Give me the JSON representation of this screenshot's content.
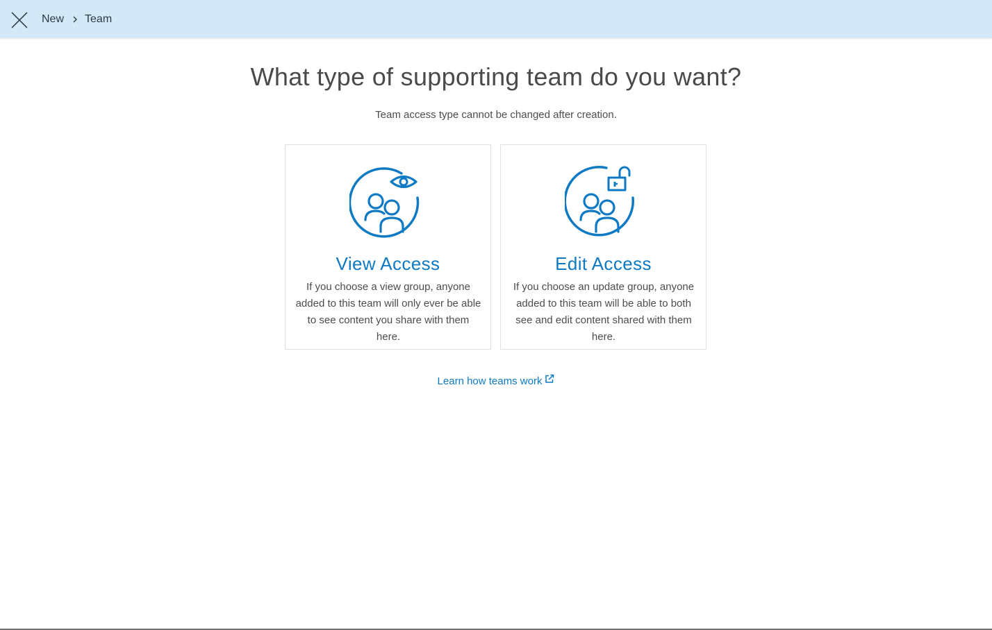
{
  "header": {
    "breadcrumb": [
      "New",
      "Team"
    ]
  },
  "main": {
    "title": "What type of supporting team do you want?",
    "subtitle": "Team access type cannot be changed after creation.",
    "cards": [
      {
        "title": "View Access",
        "description": "If you choose a view group, anyone added to this team will only ever be able to see content you share with them here.",
        "icon": "team-view-icon"
      },
      {
        "title": "Edit Access",
        "description": "If you choose an update group, anyone added to this team will be able to both see and edit content shared with them here.",
        "icon": "team-edit-icon"
      }
    ],
    "learn_link": "Learn how teams work"
  },
  "colors": {
    "header_bg": "#d4e9f7",
    "accent": "#0e7ac4",
    "text": "#4a4a4a"
  }
}
